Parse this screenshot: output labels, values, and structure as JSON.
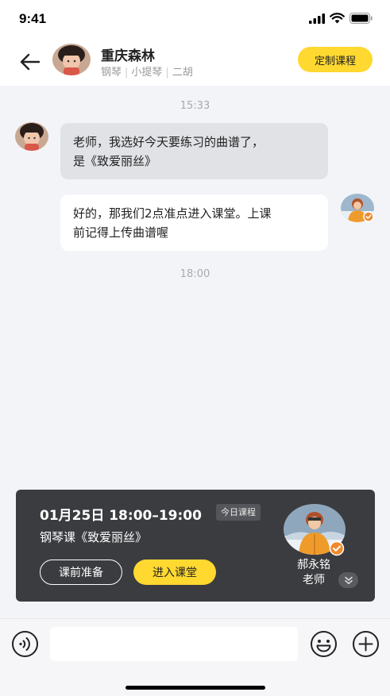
{
  "status_bar": {
    "time": "9:41"
  },
  "header": {
    "contact_name": "重庆森林",
    "tags": [
      "钢琴",
      "小提琴",
      "二胡"
    ],
    "custom_course_label": "定制课程"
  },
  "chat": {
    "timestamps": [
      "15:33",
      "18:00"
    ],
    "messages": [
      {
        "side": "left",
        "lines": [
          "老师，我选好今天要练习的曲谱了，",
          "是《致爱丽丝》"
        ]
      },
      {
        "side": "right",
        "lines": [
          "好的，那我们2点准点进入课堂。上课",
          "前记得上传曲谱喔"
        ]
      }
    ]
  },
  "course_card": {
    "datetime": "01月25日 18:00–19:00",
    "badge": "今日课程",
    "title": "钢琴课《致爱丽丝》",
    "prep_label": "课前准备",
    "enter_label": "进入课堂",
    "teacher_name": "郝永铭",
    "teacher_role": "老师"
  },
  "input_bar": {
    "placeholder": ""
  },
  "colors": {
    "accent": "#ffd830",
    "card_bg": "#3b3c40",
    "chat_bg": "#f3f4f8",
    "verified_badge": "#f08a2c"
  },
  "icons": {
    "back": "back-arrow-icon",
    "voice": "voice-icon",
    "emoji": "emoji-icon",
    "plus": "plus-icon",
    "expand": "chevron-double-down-icon",
    "verified": "verified-check-icon"
  }
}
